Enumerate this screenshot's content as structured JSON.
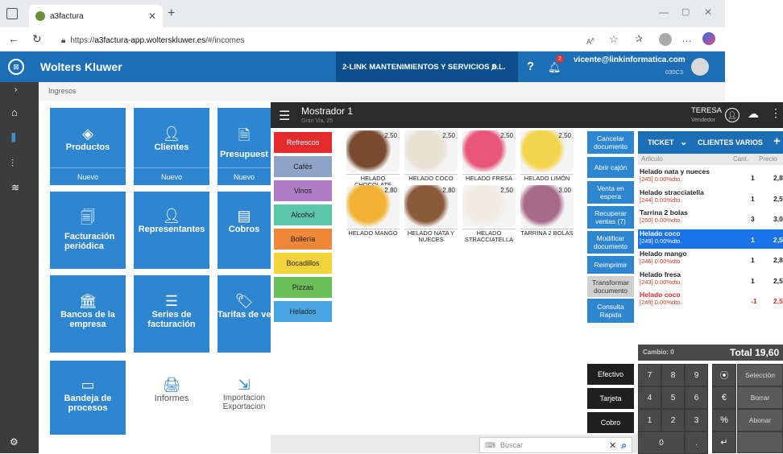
{
  "browser": {
    "tab_title": "a3factura",
    "url_prefix": "https://",
    "url_domain": "a3factura-app.wolterskluwer.es",
    "url_path": "/#/incomes"
  },
  "app": {
    "brand": "Wolters Kluwer",
    "company": "2-LINK MANTENIMIENTOS Y SERVICIOS S.L.",
    "notif_count": "2",
    "user_email": "vicente@linkinformatica.com",
    "user_code": "030C3",
    "breadcrumb": "Ingresos"
  },
  "tiles": [
    {
      "label": "Productos",
      "sub": "Nuevo"
    },
    {
      "label": "Clientes",
      "sub": "Nuevo"
    },
    {
      "label": "Presupuest",
      "sub": "Nuevo"
    },
    {
      "label": "Facturación periódica"
    },
    {
      "label": "Representantes"
    },
    {
      "label": "Cobros"
    },
    {
      "label": "Bancos de la empresa"
    },
    {
      "label": "Series de facturación"
    },
    {
      "label": "Tarifas de ve"
    },
    {
      "label": "Bandeja de procesos"
    },
    {
      "label": "Informes"
    },
    {
      "label": "Importacion Exportacion"
    }
  ],
  "pos": {
    "title": "Mostrador 1",
    "subtitle": "Gran Via, 25",
    "user": "TERESA",
    "role": "Vendedor",
    "categories": [
      {
        "label": "Refrescos",
        "color": "#e32b2b"
      },
      {
        "label": "Cafés",
        "color": "#8fa3c7"
      },
      {
        "label": "Vinos",
        "color": "#b07cc6"
      },
      {
        "label": "Alcohol",
        "color": "#5bc6a8"
      },
      {
        "label": "Bollería",
        "color": "#f0883a"
      },
      {
        "label": "Bocadillos",
        "color": "#f3d23a"
      },
      {
        "label": "Pizzas",
        "color": "#6bbf59"
      },
      {
        "label": "Helados",
        "color": "#4aa6e3"
      }
    ],
    "products": [
      {
        "name": "HELADO CHOCOLATE",
        "price": "2,50",
        "color": "#7a4a2e"
      },
      {
        "name": "HELADO COCO",
        "price": "2,50",
        "color": "#e9e1d4"
      },
      {
        "name": "HELADO FRESA",
        "price": "2,50",
        "color": "#e8577a"
      },
      {
        "name": "HELADO LIMÓN",
        "price": "2,50",
        "color": "#f3d44a"
      },
      {
        "name": "HELADO MANGO",
        "price": "2,80",
        "color": "#f2b233"
      },
      {
        "name": "HELADO NATA Y NUECES",
        "price": "2,80",
        "color": "#8a5a3a"
      },
      {
        "name": "HELADO STRACCIATELLA",
        "price": "2,50",
        "color": "#f0ece4"
      },
      {
        "name": "TARRINA 2 BOLAS",
        "price": "3,00",
        "color": "#a86a8a"
      }
    ],
    "actions": [
      "Cancelar documento",
      "Abrir cajón",
      "Venta en espera",
      "Recuperar ventas (7)",
      "Modificar documento",
      "Reimprimir",
      "Transformar documento",
      "Consulta Rapida"
    ],
    "ticket_label": "TICKET",
    "client_label": "CLIENTES VARIOS",
    "col_article": "Articulo",
    "col_qty": "Cant.",
    "col_price": "Precio",
    "lines": [
      {
        "name": "Helado nata y nueces",
        "sub": "[245] 0.00%dto.",
        "qty": "1",
        "price": "2,8"
      },
      {
        "name": "Helado stracciatella",
        "sub": "[244] 0.00%dto.",
        "qty": "1",
        "price": "2,5"
      },
      {
        "name": "Tarrina 2 bolas",
        "sub": "[250] 0.00%dto.",
        "qty": "3",
        "price": "3,0"
      },
      {
        "name": "Helado coco",
        "sub": "[249] 0.00%dto.",
        "qty": "1",
        "price": "2,5"
      },
      {
        "name": "Helado mango",
        "sub": "[246] 0.00%dto.",
        "qty": "1",
        "price": "2,8"
      },
      {
        "name": "Helado fresa",
        "sub": "[243] 0.00%dto.",
        "qty": "1",
        "price": "2,5"
      },
      {
        "name": "Helado coco",
        "sub": "[249] 0.00%dto.",
        "qty": "-1",
        "price": "2,5"
      }
    ],
    "cambio": "Cambio: 0",
    "total": "Total 19,60",
    "pay": [
      "Efectivo",
      "Tarjeta",
      "Cobro"
    ],
    "keys": [
      "7",
      "8",
      "9",
      "4",
      "5",
      "6",
      "1",
      "2",
      "3",
      "0",
      "."
    ],
    "side_keys": [
      "Selección",
      "Borrar",
      "Abonar"
    ],
    "search_placeholder": "Buscar"
  }
}
